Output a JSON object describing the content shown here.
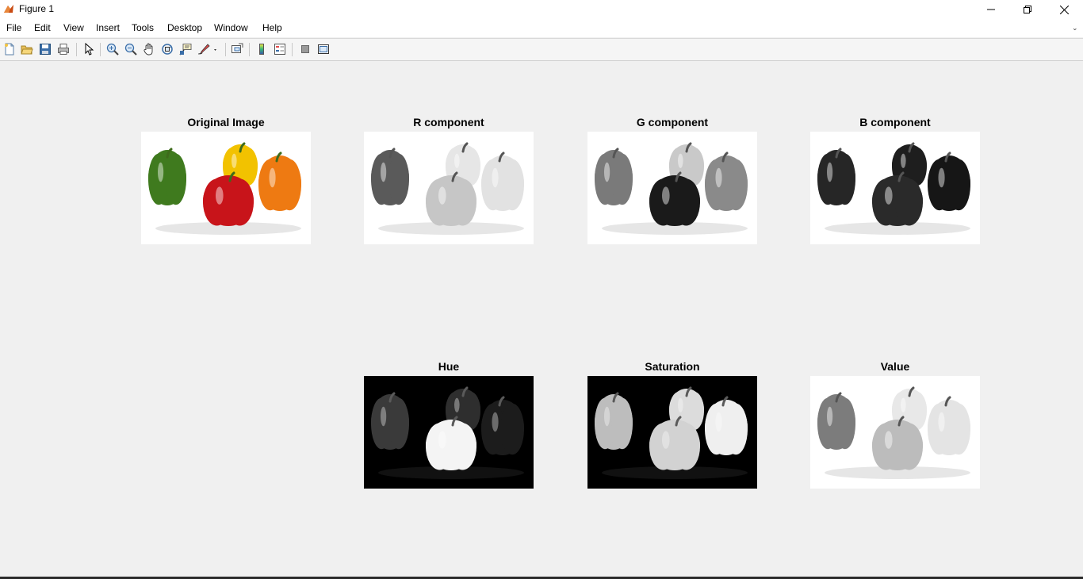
{
  "window": {
    "title": "Figure 1",
    "controls": {
      "minimize": "—",
      "maximize": "❐",
      "close": "✕"
    }
  },
  "menu": {
    "items": [
      "File",
      "Edit",
      "View",
      "Insert",
      "Tools",
      "Desktop",
      "Window",
      "Help"
    ],
    "overflow": "⌄"
  },
  "toolbar": {
    "icons": [
      "new-figure-icon",
      "open-file-icon",
      "save-icon",
      "print-icon",
      "edit-plot-arrow-icon",
      "zoom-in-icon",
      "zoom-out-icon",
      "pan-hand-icon",
      "rotate-3d-icon",
      "data-cursor-icon",
      "brush-icon",
      "link-plot-icon",
      "colorbar-icon",
      "legend-icon",
      "hide-plot-tools-icon",
      "show-plot-tools-icon"
    ]
  },
  "axes": [
    {
      "title": "Original Image",
      "mode": "color"
    },
    {
      "title": "R component",
      "mode": "r"
    },
    {
      "title": "G component",
      "mode": "g"
    },
    {
      "title": "B component",
      "mode": "b"
    },
    {
      "title": "Hue",
      "mode": "hue"
    },
    {
      "title": "Saturation",
      "mode": "sat"
    },
    {
      "title": "Value",
      "mode": "val"
    }
  ],
  "colors": {
    "figure_bg": "#f0f0f0",
    "pepper_green": "#3f7a1e",
    "pepper_red": "#c8141a",
    "pepper_yellow": "#f2c200",
    "pepper_orange": "#ee7a12"
  }
}
